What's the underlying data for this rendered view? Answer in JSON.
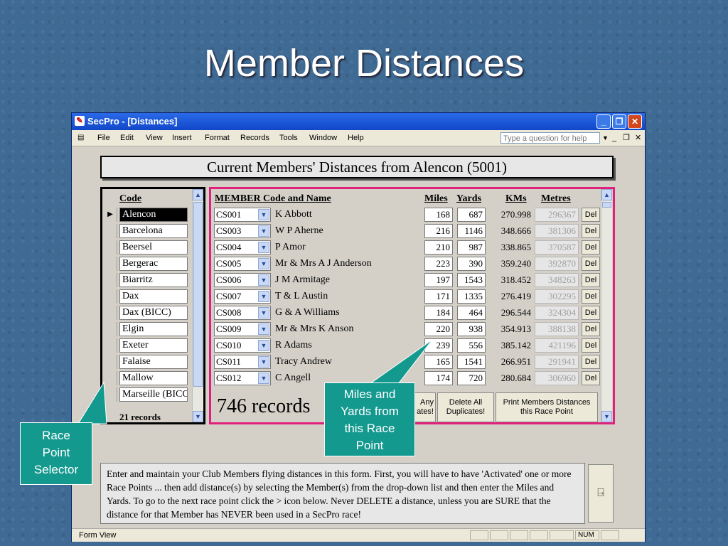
{
  "slide": {
    "title": "Member Distances"
  },
  "window": {
    "title": "SecPro - [Distances]",
    "menu": [
      "File",
      "Edit",
      "View",
      "Insert",
      "Format",
      "Records",
      "Tools",
      "Window",
      "Help"
    ],
    "ask_placeholder": "Type a question for help",
    "form_title": "Current Members' Distances from Alencon (5001)"
  },
  "race_points": {
    "header": "Code",
    "items": [
      "Alencon",
      "Barcelona",
      "Beersel",
      "Bergerac",
      "Biarritz",
      "Dax",
      "Dax (BICC)",
      "Elgin",
      "Exeter",
      "Falaise",
      "Mallow",
      "Marseille (BICC"
    ],
    "selected_index": 0,
    "count_text": "21 records"
  },
  "members": {
    "headers": {
      "member": "MEMBER Code and Name",
      "miles": "Miles",
      "yards": "Yards",
      "kms": "KMs",
      "metres": "Metres"
    },
    "rows": [
      {
        "code": "CS001",
        "name": "K Abbott",
        "miles": "168",
        "yards": "687",
        "kms": "270.998",
        "metres": "296367"
      },
      {
        "code": "CS003",
        "name": "W P Aherne",
        "miles": "216",
        "yards": "1146",
        "kms": "348.666",
        "metres": "381306"
      },
      {
        "code": "CS004",
        "name": "P Amor",
        "miles": "210",
        "yards": "987",
        "kms": "338.865",
        "metres": "370587"
      },
      {
        "code": "CS005",
        "name": "Mr & Mrs A J Anderson",
        "miles": "223",
        "yards": "390",
        "kms": "359.240",
        "metres": "392870"
      },
      {
        "code": "CS006",
        "name": "J M Armitage",
        "miles": "197",
        "yards": "1543",
        "kms": "318.452",
        "metres": "348263"
      },
      {
        "code": "CS007",
        "name": "T & L Austin",
        "miles": "171",
        "yards": "1335",
        "kms": "276.419",
        "metres": "302295"
      },
      {
        "code": "CS008",
        "name": "G & A Williams",
        "miles": "184",
        "yards": "464",
        "kms": "296.544",
        "metres": "324304"
      },
      {
        "code": "CS009",
        "name": "Mr & Mrs K Anson",
        "miles": "220",
        "yards": "938",
        "kms": "354.913",
        "metres": "388138"
      },
      {
        "code": "CS010",
        "name": "R Adams",
        "miles": "239",
        "yards": "556",
        "kms": "385.142",
        "metres": "421196"
      },
      {
        "code": "CS011",
        "name": "Tracy Andrew",
        "miles": "165",
        "yards": "1541",
        "kms": "266.951",
        "metres": "291941"
      },
      {
        "code": "CS012",
        "name": "C Angell",
        "miles": "174",
        "yards": "720",
        "kms": "280.684",
        "metres": "306960"
      }
    ],
    "del_label": "Del",
    "records_text": "746 records",
    "buttons": {
      "any": "Any\nates!",
      "delete_all": "Delete All\nDuplicates!",
      "print": "Print Members Distances\nthis Race Point"
    }
  },
  "info_text": "Enter and maintain your Club Members flying distances in this form. First, you will have to have 'Activated' one or more Race Points ... then add distance(s) by selecting the Member(s) from the drop-down list and then enter the Miles and Yards. To go to the next race point click the > icon below. Never DELETE a distance, unless you are SURE that the distance for that Member has NEVER been used in a SecPro race!",
  "status": {
    "left": "Form View",
    "right": "NUM"
  },
  "callouts": {
    "race_point": "Race\nPoint\nSelector",
    "miles": "Miles and\nYards from\nthis Race\nPoint"
  },
  "colors": {
    "panel_border": "#e0207a",
    "callout": "#14998f",
    "title_bar": "#1047c8"
  }
}
